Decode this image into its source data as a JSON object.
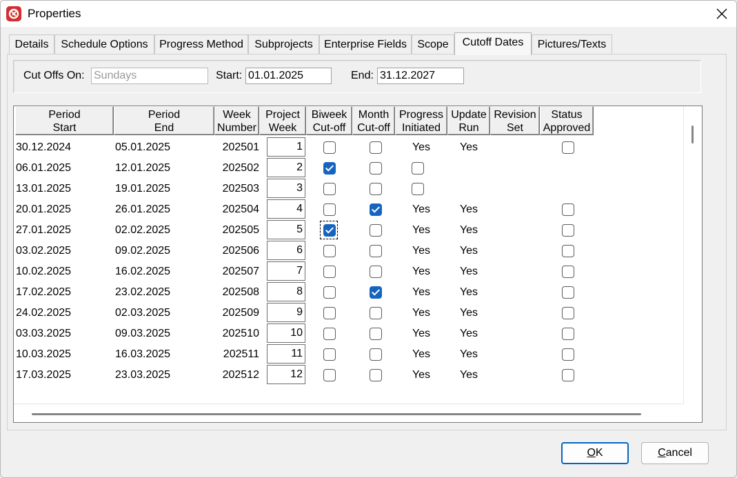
{
  "window": {
    "title": "Properties",
    "icon": "app-logo-icon"
  },
  "tabs": [
    {
      "label": "Details",
      "active": false
    },
    {
      "label": "Schedule Options",
      "active": false
    },
    {
      "label": "Progress Method",
      "active": false
    },
    {
      "label": "Subprojects",
      "active": false
    },
    {
      "label": "Enterprise Fields",
      "active": false
    },
    {
      "label": "Scope",
      "active": false
    },
    {
      "label": "Cutoff Dates",
      "active": true
    },
    {
      "label": "Pictures/Texts",
      "active": false
    }
  ],
  "filter": {
    "cutoffs_label": "Cut Offs On:",
    "cutoffs_value": "Sundays",
    "start_label": "Start:",
    "start_value": "01.01.2025",
    "end_label": "End:",
    "end_value": "31.12.2027"
  },
  "grid": {
    "headers": [
      [
        "Period",
        "Start"
      ],
      [
        "Period",
        "End"
      ],
      [
        "Week",
        "Number"
      ],
      [
        "Project",
        "Week"
      ],
      [
        "Biweek",
        "Cut-off"
      ],
      [
        "Month",
        "Cut-off"
      ],
      [
        "Progress",
        "Initiated"
      ],
      [
        "Update",
        "Run"
      ],
      [
        "Revision",
        "Set"
      ],
      [
        "Status",
        "Approved"
      ]
    ],
    "rows": [
      {
        "start": "30.12.2024",
        "end": "05.01.2025",
        "week": "202501",
        "pweek": "1",
        "biweek": false,
        "month": false,
        "progress": "Yes",
        "update": "Yes",
        "approved": "unchecked"
      },
      {
        "start": "06.01.2025",
        "end": "12.01.2025",
        "week": "202502",
        "pweek": "2",
        "biweek": true,
        "month": false,
        "progress": "checkbox",
        "update": "",
        "approved": "none"
      },
      {
        "start": "13.01.2025",
        "end": "19.01.2025",
        "week": "202503",
        "pweek": "3",
        "biweek": false,
        "month": false,
        "progress": "checkbox",
        "update": "",
        "approved": "none"
      },
      {
        "start": "20.01.2025",
        "end": "26.01.2025",
        "week": "202504",
        "pweek": "4",
        "biweek": false,
        "month": true,
        "progress": "Yes",
        "update": "Yes",
        "approved": "unchecked"
      },
      {
        "start": "27.01.2025",
        "end": "02.02.2025",
        "week": "202505",
        "pweek": "5",
        "biweek": true,
        "month": false,
        "progress": "Yes",
        "update": "Yes",
        "approved": "unchecked",
        "focused": true
      },
      {
        "start": "03.02.2025",
        "end": "09.02.2025",
        "week": "202506",
        "pweek": "6",
        "biweek": false,
        "month": false,
        "progress": "Yes",
        "update": "Yes",
        "approved": "unchecked"
      },
      {
        "start": "10.02.2025",
        "end": "16.02.2025",
        "week": "202507",
        "pweek": "7",
        "biweek": false,
        "month": false,
        "progress": "Yes",
        "update": "Yes",
        "approved": "unchecked"
      },
      {
        "start": "17.02.2025",
        "end": "23.02.2025",
        "week": "202508",
        "pweek": "8",
        "biweek": false,
        "month": true,
        "progress": "Yes",
        "update": "Yes",
        "approved": "unchecked"
      },
      {
        "start": "24.02.2025",
        "end": "02.03.2025",
        "week": "202509",
        "pweek": "9",
        "biweek": false,
        "month": false,
        "progress": "Yes",
        "update": "Yes",
        "approved": "unchecked"
      },
      {
        "start": "03.03.2025",
        "end": "09.03.2025",
        "week": "202510",
        "pweek": "10",
        "biweek": false,
        "month": false,
        "progress": "Yes",
        "update": "Yes",
        "approved": "unchecked"
      },
      {
        "start": "10.03.2025",
        "end": "16.03.2025",
        "week": "202511",
        "pweek": "11",
        "biweek": false,
        "month": false,
        "progress": "Yes",
        "update": "Yes",
        "approved": "unchecked"
      },
      {
        "start": "17.03.2025",
        "end": "23.03.2025",
        "week": "202512",
        "pweek": "12",
        "biweek": false,
        "month": false,
        "progress": "Yes",
        "update": "Yes",
        "approved": "unchecked"
      }
    ]
  },
  "buttons": {
    "ok": {
      "mnemonic": "O",
      "rest": "K"
    },
    "cancel": {
      "mnemonic": "C",
      "rest": "ancel"
    }
  },
  "colors": {
    "accent": "#1565c0",
    "app_icon": "#d32f2f"
  }
}
